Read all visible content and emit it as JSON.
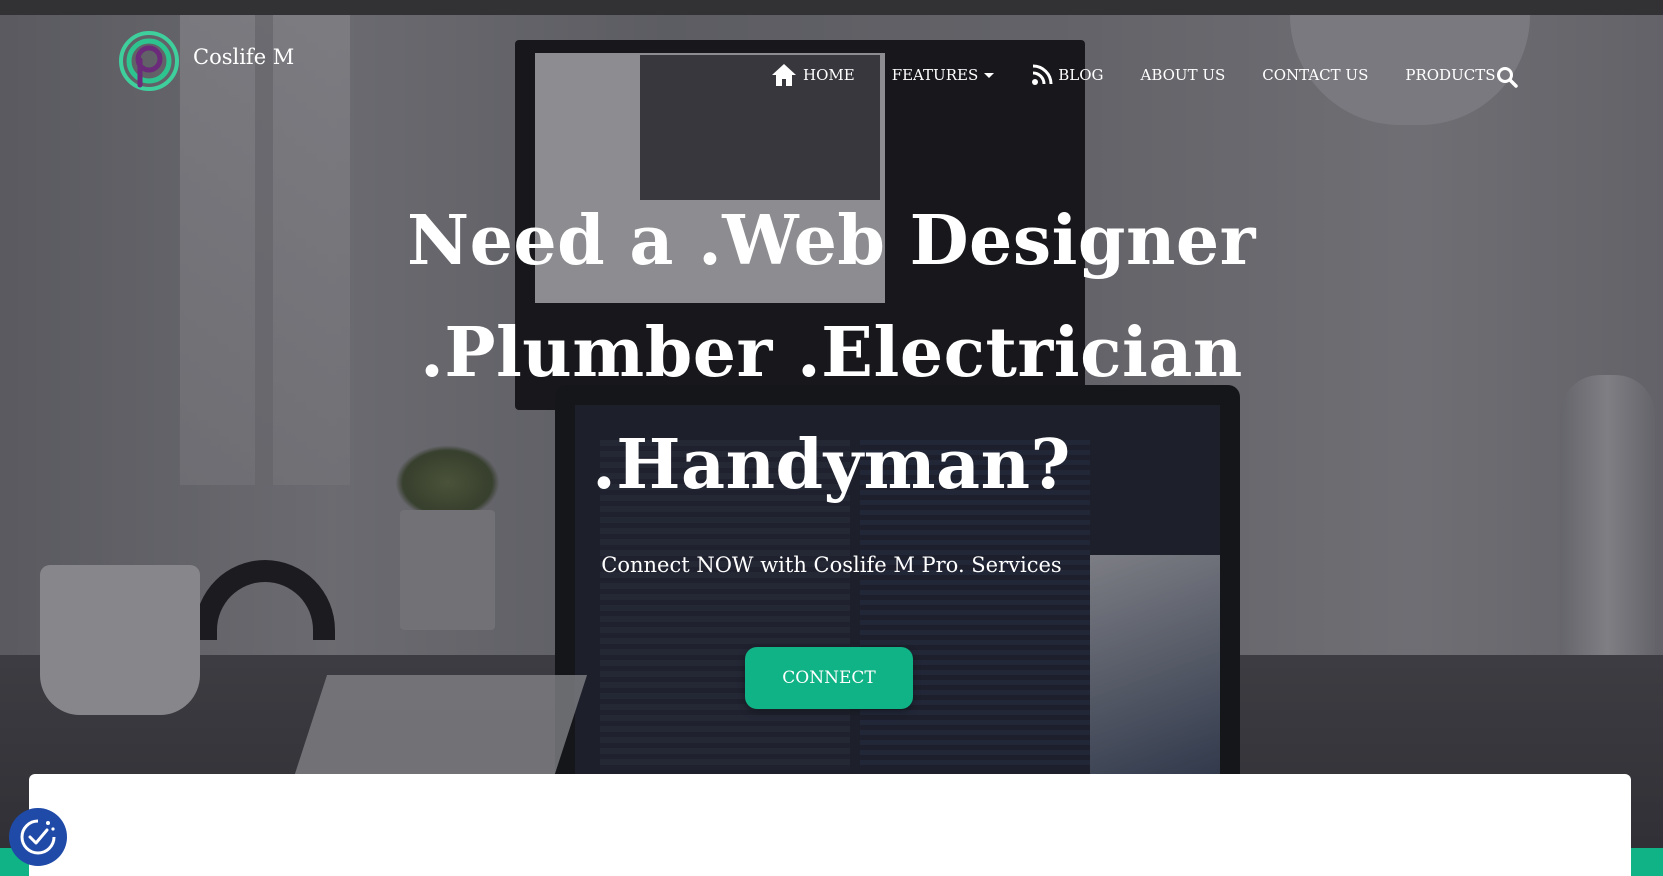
{
  "header": {
    "brand_name": "Coslife M",
    "logo_icon": "coslife-logo-icon"
  },
  "nav": {
    "items": [
      {
        "label": "HOME",
        "icon": "home-icon"
      },
      {
        "label": "FEATURES",
        "icon": "chevron-down-icon"
      },
      {
        "label": "BLOG",
        "icon": "rss-icon"
      },
      {
        "label": "ABOUT US"
      },
      {
        "label": "CONTACT US"
      },
      {
        "label": "PRODUCTS"
      }
    ],
    "search_icon": "search-icon"
  },
  "hero": {
    "headline_lines": [
      "Need a .Web Designer",
      ".Plumber .Electrician",
      ".Handyman?"
    ],
    "subheadline": "Connect NOW with Coslife M Pro. Services",
    "cta_label": "CONNECT"
  },
  "widgets": {
    "consent_icon": "cookie-consent-icon"
  },
  "colors": {
    "accent_green": "#10b386",
    "consent_blue": "#1f4aa8",
    "logo_purple": "#6b2a7a",
    "text_white": "#ffffff"
  }
}
